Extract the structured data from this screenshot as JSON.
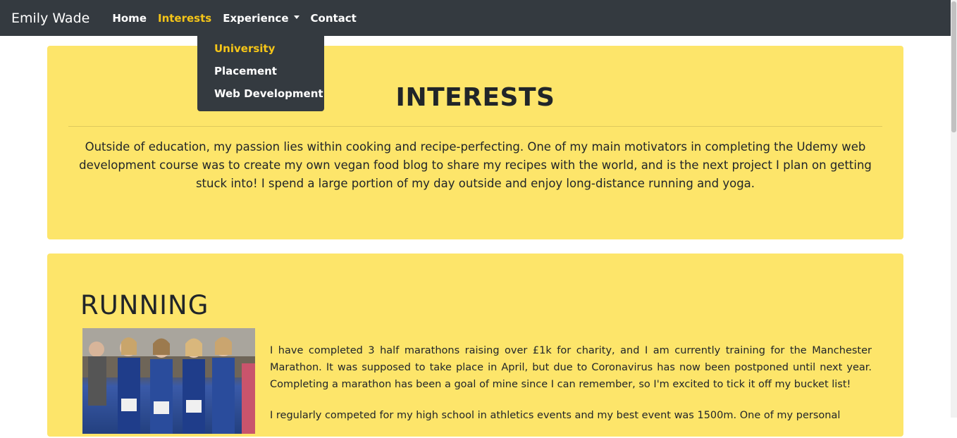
{
  "navbar": {
    "brand": "Emily Wade",
    "links": [
      {
        "label": "Home",
        "active": false
      },
      {
        "label": "Interests",
        "active": true
      },
      {
        "label": "Experience",
        "active": false,
        "has_dropdown": true
      },
      {
        "label": "Contact",
        "active": false
      }
    ],
    "dropdown": {
      "items": [
        {
          "label": "University",
          "active": true
        },
        {
          "label": "Placement",
          "active": false
        },
        {
          "label": "Web Development",
          "active": false
        }
      ]
    }
  },
  "interests": {
    "title": "INTERESTS",
    "text": "Outside of education, my passion lies within cooking and recipe-perfecting. One of my main motivators in completing the Udemy web development course was to create my own vegan food blog to share my recipes with the world, and is the next project I plan on getting stuck into! I spend a large portion of my day outside and enjoy long-distance running and yoga."
  },
  "running": {
    "title": "RUNNING",
    "photo_icon": "runners-photo",
    "paragraphs": [
      "I have completed 3 half marathons raising over £1k for charity, and I am currently training for the Manchester Marathon. It was supposed to take place in April, but due to Coronavirus has now been postponed until next year. Completing a marathon has been a goal of mine since I can remember, so I'm excited to tick it off my bucket list!",
      "I regularly competed for my high school in athletics events and my best event was 1500m. One of my personal"
    ]
  },
  "colors": {
    "navbar_bg": "#343a40",
    "accent": "#f5c518",
    "card_bg": "#fde56a"
  }
}
